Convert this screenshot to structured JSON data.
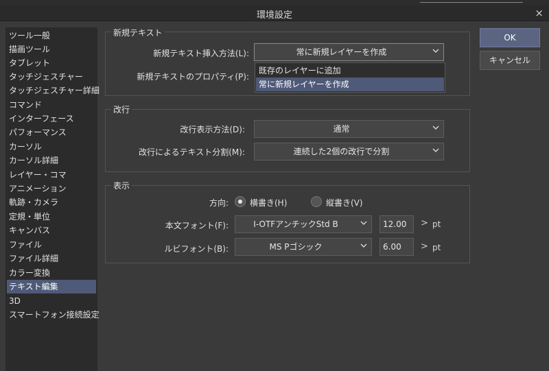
{
  "window": {
    "title": "環境設定"
  },
  "sidebar": {
    "items": [
      {
        "label": "ツール一般"
      },
      {
        "label": "描画ツール"
      },
      {
        "label": "タブレット"
      },
      {
        "label": "タッチジェスチャー"
      },
      {
        "label": "タッチジェスチャー詳細"
      },
      {
        "label": "コマンド"
      },
      {
        "label": "インターフェース"
      },
      {
        "label": "パフォーマンス"
      },
      {
        "label": "カーソル"
      },
      {
        "label": "カーソル詳細"
      },
      {
        "label": "レイヤー・コマ"
      },
      {
        "label": "アニメーション"
      },
      {
        "label": "軌跡・カメラ"
      },
      {
        "label": "定規・単位"
      },
      {
        "label": "キャンバス"
      },
      {
        "label": "ファイル"
      },
      {
        "label": "ファイル詳細"
      },
      {
        "label": "カラー変換"
      },
      {
        "label": "テキスト編集"
      },
      {
        "label": "3D"
      },
      {
        "label": "スマートフォン接続設定"
      }
    ],
    "selected": "テキスト編集"
  },
  "new_text": {
    "group_label": "新規テキスト",
    "insert_method_label": "新規テキスト挿入方法(L):",
    "insert_method_value": "常に新規レイヤーを作成",
    "property_label": "新規テキストのプロパティ(P):",
    "dropdown_options": [
      "既存のレイヤーに追加",
      "常に新規レイヤーを作成"
    ]
  },
  "line_break": {
    "group_label": "改行",
    "display_label": "改行表示方法(D):",
    "display_value": "通常",
    "split_label": "改行によるテキスト分割(M):",
    "split_value": "連続した2個の改行で分割"
  },
  "display": {
    "group_label": "表示",
    "direction_label": "方向:",
    "horizontal_label": "横書き(H)",
    "vertical_label": "縦書き(V)",
    "body_font_label": "本文フォント(F):",
    "body_font_value": "I-OTFアンチックStd B",
    "body_size": "12.00",
    "ruby_font_label": "ルビフォント(B):",
    "ruby_font_value": "MS Pゴシック",
    "ruby_size": "6.00",
    "unit": "pt",
    "arrow": ">"
  },
  "buttons": {
    "ok": "OK",
    "cancel": "キャンセル"
  },
  "icons": {
    "close": "×"
  },
  "colors": {
    "selection": "#4f5978",
    "ok_button": "#5b6582",
    "background": "#3a3a3a"
  }
}
